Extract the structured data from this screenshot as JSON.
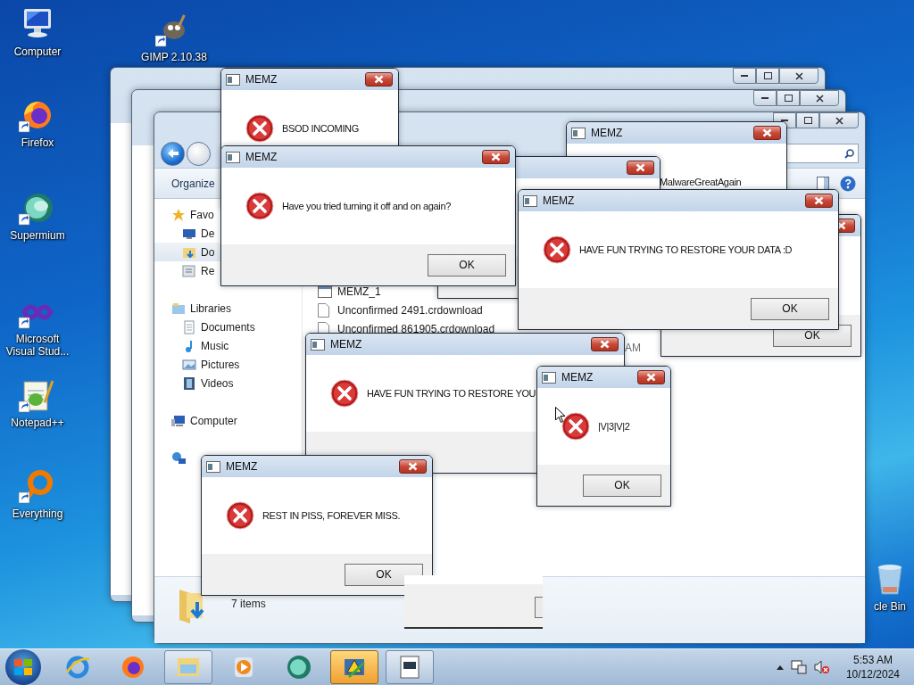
{
  "desktop_icons": [
    {
      "label": "Computer",
      "kind": "computer",
      "shortcut": false
    },
    {
      "label": "GIMP 2.10.38",
      "kind": "gimp",
      "shortcut": true
    },
    {
      "label": "Firefox",
      "kind": "firefox",
      "shortcut": true
    },
    {
      "label": "Supermium",
      "kind": "supermium",
      "shortcut": true
    },
    {
      "label": "Microsoft Visual Stud...",
      "kind": "vs",
      "shortcut": true
    },
    {
      "label": "Notepad++",
      "kind": "notepad",
      "shortcut": true
    },
    {
      "label": "Everything",
      "kind": "everything",
      "shortcut": true
    },
    {
      "label": "cle Bin",
      "kind": "recycle",
      "shortcut": false
    }
  ],
  "explorer": {
    "toolbar": {
      "organize": "Organize"
    },
    "sidebar": [
      {
        "label": "Favo",
        "kind": "favorites",
        "selected": false,
        "children": [
          {
            "label": "De",
            "kind": "desktop",
            "selected": false
          },
          {
            "label": "Do",
            "kind": "downloads",
            "selected": true
          },
          {
            "label": "Re",
            "kind": "recent",
            "selected": false
          }
        ]
      },
      {
        "label": "Libraries",
        "kind": "libraries",
        "selected": false,
        "children": [
          {
            "label": "Documents",
            "kind": "documents",
            "selected": false
          },
          {
            "label": "Music",
            "kind": "music",
            "selected": false
          },
          {
            "label": "Pictures",
            "kind": "pictures",
            "selected": false
          },
          {
            "label": "Videos",
            "kind": "videos",
            "selected": false
          }
        ]
      },
      {
        "label": "Computer",
        "kind": "computer",
        "selected": false
      },
      {
        "kind": "network",
        "selected": false
      }
    ],
    "files": [
      {
        "name": "MEMZ_1",
        "kind": "app"
      },
      {
        "name": "Unconfirmed 2491.crdownload",
        "kind": "file"
      },
      {
        "name": "Unconfirmed 861905.crdownload",
        "kind": "file"
      },
      {
        "date": "AM",
        "kind": "none"
      }
    ],
    "status": "7 items"
  },
  "dialogs": [
    {
      "kind": "dialog",
      "title": "MEMZ",
      "message": "BSOD INCOMING"
    },
    {
      "kind": "dialog",
      "title": "MEMZ",
      "message": "MalwareGreatAgain"
    },
    {
      "kind": "dialog"
    },
    {
      "kind": "dialog",
      "button": "OK"
    },
    {
      "kind": "dialog",
      "title": "MEMZ",
      "message": "Have you tried turning it off and on again?",
      "button": "OK"
    },
    {
      "kind": "dialog",
      "title": "MEMZ",
      "message": "HAVE FUN TRYING TO RESTORE YOUR DATA :D",
      "button": "OK"
    },
    {
      "kind": "dialog",
      "title": "MEMZ",
      "message": "HAVE FUN TRYING TO RESTORE YOU"
    },
    {
      "kind": "dialog",
      "title": "MEMZ",
      "message": "|V|3|V|2",
      "button": "OK"
    },
    {
      "kind": "dialog",
      "title": "MEMZ",
      "message": "REST IN PISS, FOREVER MISS.",
      "button": "OK"
    },
    {
      "kind": "fragment"
    }
  ],
  "taskbar": {
    "apps": [
      {
        "kind": "ie",
        "running": false,
        "selected": false
      },
      {
        "kind": "firefox",
        "running": false,
        "selected": false
      },
      {
        "kind": "explorer",
        "running": true,
        "selected": false
      },
      {
        "kind": "media",
        "running": false,
        "selected": false
      },
      {
        "kind": "supermium",
        "running": false,
        "selected": false
      },
      {
        "kind": "memz",
        "running": true,
        "selected": true
      },
      {
        "kind": "doc",
        "running": true,
        "selected": false
      }
    ],
    "time": "5:53 AM",
    "date": "10/12/2024"
  }
}
